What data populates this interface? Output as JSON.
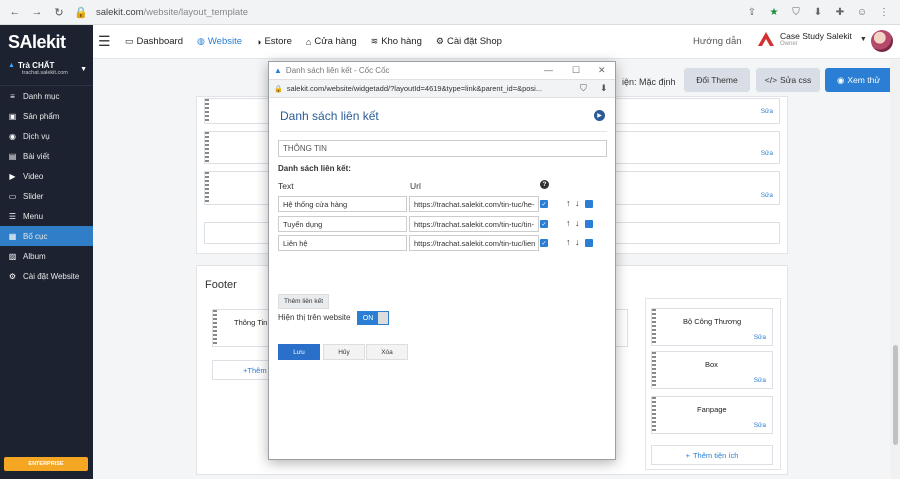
{
  "browser": {
    "url_host": "salekit.com",
    "url_path": "/website/layout_template"
  },
  "sidebar": {
    "brand": "SAlekit",
    "shop_name": "Trà CHẤT",
    "shop_domain": "trachat.salekit.com",
    "items": [
      {
        "label": "Danh mục",
        "icon": "list-icon"
      },
      {
        "label": "Sản phẩm",
        "icon": "box-icon"
      },
      {
        "label": "Dịch vụ",
        "icon": "service-icon"
      },
      {
        "label": "Bài viết",
        "icon": "article-icon"
      },
      {
        "label": "Video",
        "icon": "video-icon"
      },
      {
        "label": "Slider",
        "icon": "slider-icon"
      },
      {
        "label": "Menu",
        "icon": "menu-icon"
      },
      {
        "label": "Bố cục",
        "icon": "layout-icon"
      },
      {
        "label": "Album",
        "icon": "image-icon"
      },
      {
        "label": "Cài đặt Website",
        "icon": "gear-icon"
      }
    ],
    "active_item": "Bố cục",
    "plan_badge": "ENTERPRISE"
  },
  "topbar": {
    "nav": [
      {
        "label": "Dashboard",
        "icon": "monitor-icon"
      },
      {
        "label": "Website",
        "icon": "globe-icon"
      },
      {
        "label": "Estore",
        "icon": "compass-icon"
      },
      {
        "label": "Cửa hàng",
        "icon": "store-icon"
      },
      {
        "label": "Kho hàng",
        "icon": "database-icon"
      },
      {
        "label": "Cài đặt Shop",
        "icon": "gear-icon"
      }
    ],
    "active_nav": "Website",
    "guide": "Hướng dẫn",
    "account_name": "Case Study Salekit",
    "account_role": "Owner"
  },
  "page": {
    "theme_label": "iện: Mặc định",
    "change_theme": "Đổi Theme",
    "edit_css": "Sửa css",
    "preview": "Xem thử",
    "edit_label": "Sửa",
    "footer_title": "Footer",
    "footer_widgets": {
      "col1": "Thông Tin",
      "col3": [
        "Bộ Công Thương",
        "Box",
        "Fanpage"
      ]
    },
    "add_widget": "Thêm tiện ích",
    "add_short": "Thêm"
  },
  "popup": {
    "window_title": "Danh sách liên kết - Cốc Cốc",
    "url": "salekit.com/website/widgetadd/?layoutId=4619&type=link&parent_id=&posi...",
    "heading": "Danh sách liên kết",
    "title_value": "THÔNG TIN",
    "list_label": "Danh sách liên kết:",
    "col_text": "Text",
    "col_url": "Url",
    "links": [
      {
        "text": "Hệ thống cửa hàng",
        "url": "https://trachat.salekit.com/tin-tuc/he-"
      },
      {
        "text": "Tuyển dụng",
        "url": "https://trachat.salekit.com/tin-tuc/tin-"
      },
      {
        "text": "Liên hệ",
        "url": "https://trachat.salekit.com/tin-tuc/lien"
      }
    ],
    "add_link": "Thêm liên kết",
    "show_label": "Hiện thị trên website",
    "toggle_on": "ON",
    "save": "Lưu",
    "cancel": "Hủy",
    "delete": "Xóa"
  },
  "colors": {
    "sidebar_bg": "#1c2230",
    "accent": "#2a7fd4",
    "active_menu": "#2f7ec7",
    "badge": "#f5a623"
  }
}
